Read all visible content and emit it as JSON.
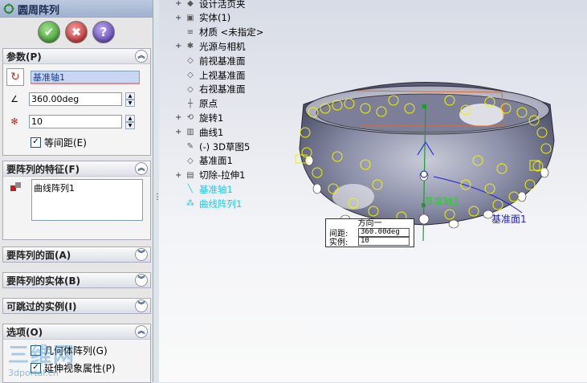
{
  "panel": {
    "title": "圆周阵列",
    "icons": {
      "title": "circular-pattern-icon",
      "ok": "check-icon",
      "cancel": "x-icon",
      "help": "question-icon"
    },
    "ok_symbol": "✔",
    "cancel_symbol": "✖",
    "help_symbol": "?",
    "params": {
      "header": "参数(P)",
      "axis_value": "基准轴1",
      "angle_value": "360.00deg",
      "count_value": "10",
      "equal_spacing_label": "等间距(E)",
      "equal_spacing_checked": true
    },
    "features": {
      "header": "要阵列的特征(F)",
      "items": [
        "曲线阵列1"
      ]
    },
    "faces": {
      "header": "要阵列的面(A)"
    },
    "bodies": {
      "header": "要阵列的实体(B)"
    },
    "skip": {
      "header": "可跳过的实例(I)"
    },
    "options": {
      "header": "选项(O)",
      "geometry_pattern_label": "几何体阵列(G)",
      "propagate_label": "延伸视象属性(P)"
    }
  },
  "tree": {
    "items": [
      {
        "label": "设计活页夹",
        "icon": "folder-icon",
        "expandable": true,
        "highlight": false
      },
      {
        "label": "实体(1)",
        "icon": "solid-body-icon",
        "expandable": true,
        "highlight": false
      },
      {
        "label": "材质 <未指定>",
        "icon": "material-icon",
        "expandable": false,
        "highlight": false
      },
      {
        "label": "光源与相机",
        "icon": "lights-icon",
        "expandable": true,
        "highlight": false
      },
      {
        "label": "前视基准面",
        "icon": "plane-icon",
        "expandable": false,
        "highlight": false
      },
      {
        "label": "上视基准面",
        "icon": "plane-icon",
        "expandable": false,
        "highlight": false
      },
      {
        "label": "右视基准面",
        "icon": "plane-icon",
        "expandable": false,
        "highlight": false
      },
      {
        "label": "原点",
        "icon": "origin-icon",
        "expandable": false,
        "highlight": false
      },
      {
        "label": "旋转1",
        "icon": "revolve-icon",
        "expandable": true,
        "highlight": false
      },
      {
        "label": "曲线1",
        "icon": "curve-icon",
        "expandable": true,
        "highlight": false
      },
      {
        "label": "(-) 3D草图5",
        "icon": "sketch-icon",
        "expandable": false,
        "highlight": false
      },
      {
        "label": "基准面1",
        "icon": "plane-icon",
        "expandable": false,
        "highlight": false
      },
      {
        "label": "切除-拉伸1",
        "icon": "cut-extrude-icon",
        "expandable": true,
        "highlight": false
      },
      {
        "label": "基准轴1",
        "icon": "axis-icon",
        "expandable": false,
        "highlight": true
      },
      {
        "label": "曲线阵列1",
        "icon": "curve-pattern-icon",
        "expandable": false,
        "highlight": true
      }
    ]
  },
  "viewport": {
    "axis_label": "基准轴1",
    "plane_label": "基准面1",
    "callout": {
      "title": "方向一",
      "spacing_label": "间距:",
      "spacing_value": "360.00deg",
      "count_label": "实例:",
      "count_value": "10"
    }
  },
  "watermark": {
    "text": "三维网",
    "url_text": "3dportal.cn"
  },
  "colors": {
    "highlight": "#19c8f0",
    "preview": "#f2f200",
    "axis_label": "#2ecc2e",
    "plane_label": "#2020d0"
  }
}
